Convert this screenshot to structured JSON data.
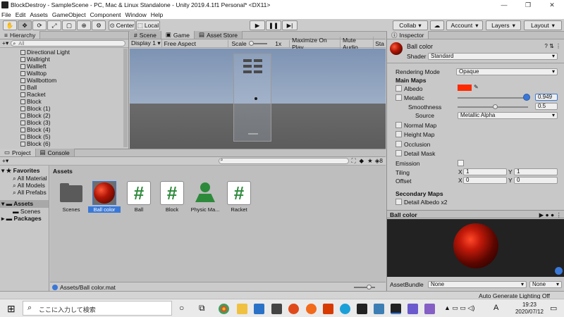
{
  "window": {
    "title": "BlockDestroy - SampleScene - PC, Mac & Linux Standalone - Unity 2019.4.1f1 Personal* <DX11>",
    "controls": [
      "—",
      "❐",
      "✕"
    ]
  },
  "menu": [
    "File",
    "Edit",
    "Assets",
    "GameObject",
    "Component",
    "Window",
    "Help"
  ],
  "toolbar": {
    "center": "Center",
    "local": "Local",
    "collab": "Collab",
    "account": "Account",
    "layers": "Layers",
    "layout": "Layout"
  },
  "hierarchy": {
    "tab": "Hierarchy",
    "search_placeholder": "All",
    "items": [
      "Directional Light",
      "Wallright",
      "Wallleft",
      "Walltop",
      "Wallbottom",
      "Ball",
      "Racket",
      "Block",
      "Block (1)",
      "Block (2)",
      "Block (3)",
      "Block (4)",
      "Block (5)",
      "Block (6)"
    ]
  },
  "game": {
    "tabs": [
      "Scene",
      "Game",
      "Asset Store"
    ],
    "display": "Display 1",
    "aspect": "Free Aspect",
    "scale_label": "Scale",
    "scale_value": "1x",
    "maximize": "Maximize On Play",
    "mute": "Mute Audio",
    "stats": "Sta"
  },
  "project": {
    "tabs": [
      "Project",
      "Console"
    ],
    "favorites": "Favorites",
    "favorite_items": [
      "All Material",
      "All Models",
      "All Prefabs"
    ],
    "assets_label": "Assets",
    "asset_subitems": [
      "Scenes"
    ],
    "packages": "Packages",
    "breadcrumb": "Assets",
    "hidden_count": "8",
    "assets": [
      "Scenes",
      "Ball color",
      "Ball",
      "Block",
      "Physic Ma...",
      "Racket"
    ],
    "selected_path": "Assets/Ball color.mat"
  },
  "inspector": {
    "tab": "Inspector",
    "name": "Ball color",
    "shader_label": "Shader",
    "shader": "Standard",
    "rendering_mode_label": "Rendering Mode",
    "rendering_mode": "Opaque",
    "main_maps": "Main Maps",
    "albedo": "Albedo",
    "albedo_color": "#ff2a00",
    "metallic": "Metallic",
    "metallic_value": "0.949",
    "smoothness": "Smoothness",
    "smoothness_value": "0.5",
    "source_label": "Source",
    "source": "Metallic Alpha",
    "normal_map": "Normal Map",
    "height_map": "Height Map",
    "occlusion": "Occlusion",
    "detail_mask": "Detail Mask",
    "emission": "Emission",
    "tiling": "Tiling",
    "offset": "Offset",
    "tiling_x": "1",
    "tiling_y": "1",
    "offset_x": "0",
    "offset_y": "0",
    "x_label": "X",
    "y_label": "Y",
    "secondary_maps": "Secondary Maps",
    "detail_albedo": "Detail Albedo x2",
    "preview_title": "Ball color",
    "asset_bundle_label": "AssetBundle",
    "asset_bundle": "None",
    "asset_bundle_variant": "None"
  },
  "status": {
    "text": "Auto Generate Lighting Off"
  },
  "taskbar": {
    "search_placeholder": "ここに入力して検索",
    "time": "19:23",
    "date": "2020/07/12",
    "ime": "A"
  },
  "colors": {
    "accent": "#3a78d8",
    "ball": "#c41a0a"
  }
}
